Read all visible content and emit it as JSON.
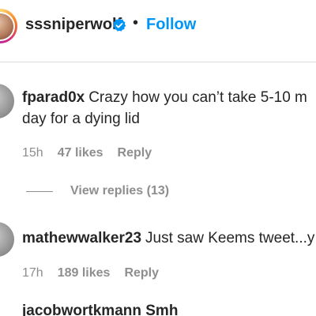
{
  "header": {
    "username": "sssniperwolf",
    "separator": "•",
    "follow_label": "Follow",
    "verified_icon": "verified-badge-icon",
    "accent_color": "#0095f6"
  },
  "comments": [
    {
      "username": "fparad0x",
      "text_line1": "Crazy how you can’t take 5-10 m",
      "text_line2": "day for a dying lid",
      "time": "15h",
      "likes": "47 likes",
      "reply_label": "Reply",
      "view_replies": "View replies (13)"
    },
    {
      "username": "mathewwalker23",
      "text_line1": "Just saw Keems tweet...y",
      "time": "17h",
      "likes": "189 likes",
      "reply_label": "Reply"
    },
    {
      "partial_text": "jacobwortkmann Smh"
    }
  ]
}
